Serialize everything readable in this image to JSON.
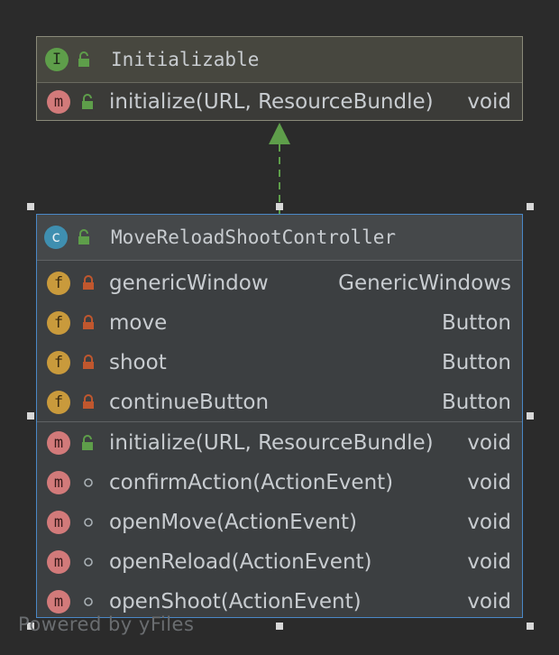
{
  "interface": {
    "badge": "I",
    "name": "Initializable",
    "methods": [
      {
        "badge": "m",
        "visibility": "public",
        "name": "initialize(URL, ResourceBundle)",
        "type": "void"
      }
    ]
  },
  "class": {
    "badge": "c",
    "name": "MoveReloadShootController",
    "fields": [
      {
        "badge": "f",
        "visibility": "private",
        "name": "genericWindow",
        "type": "GenericWindows"
      },
      {
        "badge": "f",
        "visibility": "private",
        "name": "move",
        "type": "Button"
      },
      {
        "badge": "f",
        "visibility": "private",
        "name": "shoot",
        "type": "Button"
      },
      {
        "badge": "f",
        "visibility": "private",
        "name": "continueButton",
        "type": "Button"
      }
    ],
    "methods": [
      {
        "badge": "m",
        "visibility": "public",
        "name": "initialize(URL, ResourceBundle)",
        "type": "void"
      },
      {
        "badge": "m",
        "visibility": "package",
        "name": "confirmAction(ActionEvent)",
        "type": "void"
      },
      {
        "badge": "m",
        "visibility": "package",
        "name": "openMove(ActionEvent)",
        "type": "void"
      },
      {
        "badge": "m",
        "visibility": "package",
        "name": "openReload(ActionEvent)",
        "type": "void"
      },
      {
        "badge": "m",
        "visibility": "package",
        "name": "openShoot(ActionEvent)",
        "type": "void"
      }
    ]
  },
  "relation": {
    "kind": "implements"
  },
  "footer": "Powered by yFiles",
  "colors": {
    "selection": "#4a88c7",
    "arrow": "#5e9e4a",
    "private": "#c0572e",
    "public": "#5e9e4a"
  }
}
